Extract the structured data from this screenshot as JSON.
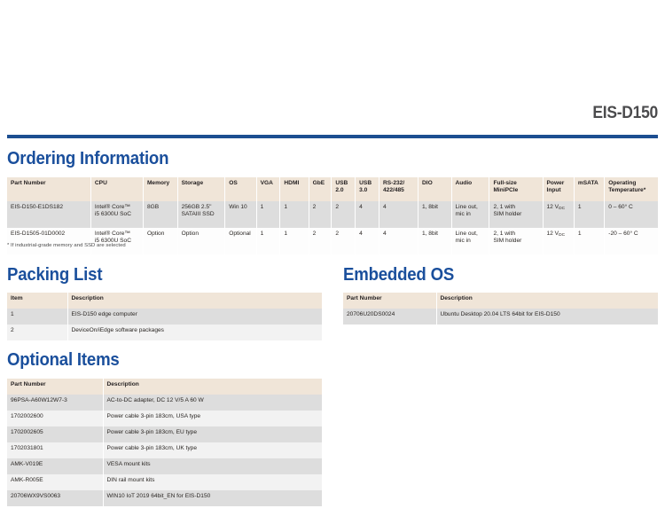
{
  "header": {
    "model": "EIS-D150"
  },
  "sections": {
    "ordering": "Ordering Information",
    "packing": "Packing List",
    "embedded": "Embedded OS",
    "optional": "Optional Items"
  },
  "ordering": {
    "note": "* If industrial-grade memory and SSD are selected",
    "columns": [
      "Part Number",
      "CPU",
      "Memory",
      "Storage",
      "OS",
      "VGA",
      "HDMI",
      "GbE",
      "USB 2.0",
      "USB 3.0",
      "RS-232/ 422/485",
      "DIO",
      "Audio",
      "Full-size MiniPCIe",
      "Power Input",
      "mSATA",
      "Operating Temperature*"
    ],
    "columns_split": [
      [
        "Part Number"
      ],
      [
        "CPU"
      ],
      [
        "Memory"
      ],
      [
        "Storage"
      ],
      [
        "OS"
      ],
      [
        "VGA"
      ],
      [
        "HDMI"
      ],
      [
        "GbE"
      ],
      [
        "USB",
        "2.0"
      ],
      [
        "USB",
        "3.0"
      ],
      [
        "RS-232/",
        "422/485"
      ],
      [
        "DIO"
      ],
      [
        "Audio"
      ],
      [
        "Full-size",
        "MiniPCIe"
      ],
      [
        "Power",
        "Input"
      ],
      [
        "mSATA"
      ],
      [
        "Operating",
        "Temperature*"
      ]
    ],
    "rows": [
      {
        "part_number": "EIS-D150-E1DS182",
        "cpu_line1": "Intel® Core™",
        "cpu_line2": "i5 6300U SoC",
        "memory": "8GB",
        "storage_line1": "256GB 2.5\"",
        "storage_line2": "SATAIII SSD",
        "os": "Win 10",
        "vga": "1",
        "hdmi": "1",
        "gbe": "2",
        "usb20": "2",
        "usb30": "4",
        "rs232": "4",
        "dio": "1, 8bit",
        "audio_line1": "Line out,",
        "audio_line2": "mic in",
        "minipcie_line1": "2, 1 with",
        "minipcie_line2": "SIM holder",
        "power_value": "12 V",
        "power_sub": "DC",
        "msata": "1",
        "temp": "0 – 60° C"
      },
      {
        "part_number": "EIS-D1505-01D0002",
        "cpu_line1": "Intel® Core™",
        "cpu_line2": "i5 6300U SoC",
        "memory": "Option",
        "storage_line1": "Option",
        "storage_line2": "",
        "os": "Optional",
        "vga": "1",
        "hdmi": "1",
        "gbe": "2",
        "usb20": "2",
        "usb30": "4",
        "rs232": "4",
        "dio": "1, 8bit",
        "audio_line1": "Line out,",
        "audio_line2": "mic in",
        "minipcie_line1": "2, 1 with",
        "minipcie_line2": "SIM holder",
        "power_value": "12 V",
        "power_sub": "DC",
        "msata": "1",
        "temp": "-20 – 60° C"
      }
    ]
  },
  "packing": {
    "columns": [
      "Item",
      "Description"
    ],
    "rows": [
      {
        "item": "1",
        "description": "EIS-D150 edge computer"
      },
      {
        "item": "2",
        "description": "DeviceOn/iEdge software packages"
      }
    ]
  },
  "embedded": {
    "columns": [
      "Part Number",
      "Description"
    ],
    "rows": [
      {
        "part_number": "20706U20DS0024",
        "description": "Ubuntu Desktop 20.04 LTS 64bit for EIS-D150"
      }
    ]
  },
  "optional": {
    "columns": [
      "Part Number",
      "Description"
    ],
    "rows": [
      {
        "part_number": "96PSA-A60W12W7-3",
        "description": "AC-to-DC adapter, DC 12 V/5 A 60 W"
      },
      {
        "part_number": "1702002600",
        "description": "Power cable 3-pin 183cm, USA type"
      },
      {
        "part_number": "1702002605",
        "description": "Power cable 3-pin 183cm, EU type"
      },
      {
        "part_number": "1702031801",
        "description": "Power cable 3-pin 183cm, UK type"
      },
      {
        "part_number": "AMK-V019E",
        "description": "VESA mount kits"
      },
      {
        "part_number": "AMK-R005E",
        "description": "DIN rail mount kits"
      },
      {
        "part_number": "20706WX9VS0063",
        "description": "WIN10 IoT 2019 64bit_EN for EIS-D150"
      }
    ]
  },
  "colors": {
    "brand_blue": "#1a4f9c",
    "rule_blue": "#1c4e91",
    "table_header_beige": "#f0e5d8",
    "row_shade_gray": "#dddddd",
    "title_gray": "#4b4b4d"
  }
}
